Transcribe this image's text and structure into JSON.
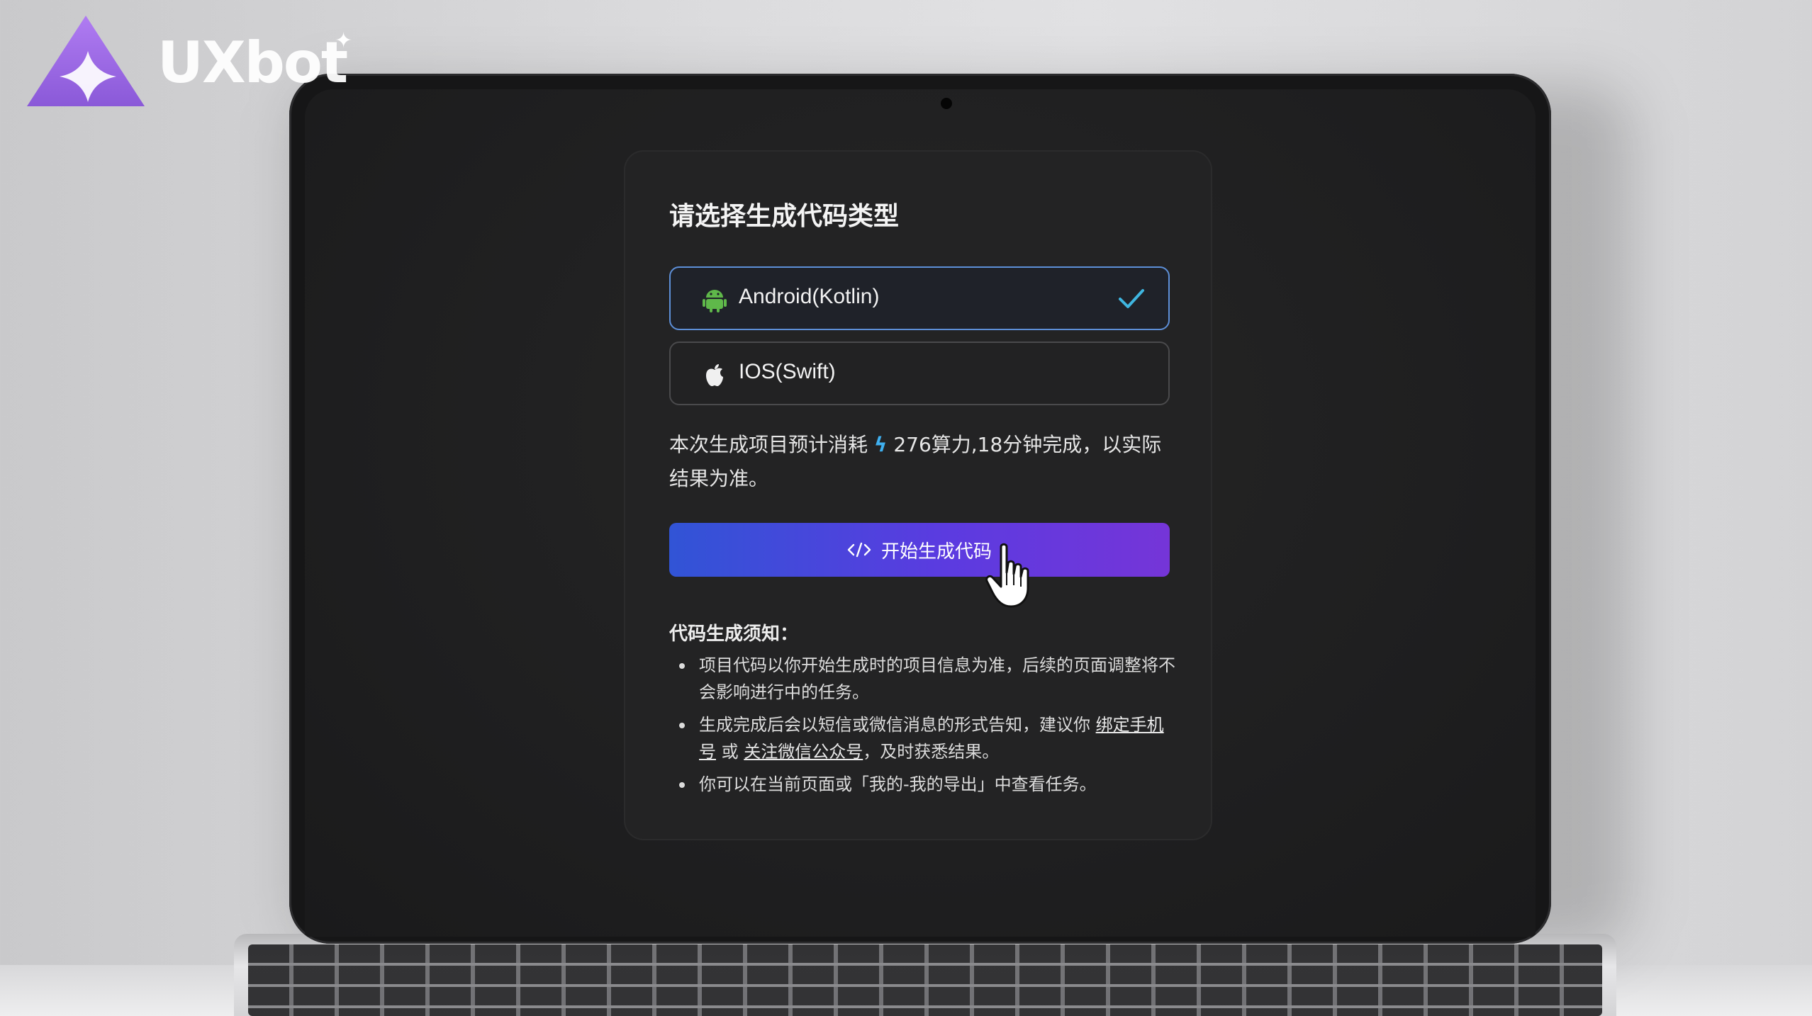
{
  "brand": {
    "name": "UXbot",
    "logo_icon": "uxbot-triangle-logo-icon",
    "sparkle": "✦"
  },
  "dialog": {
    "title": "请选择生成代码类型",
    "options": [
      {
        "label": "Android(Kotlin)",
        "icon": "android-icon",
        "selected": true
      },
      {
        "label": "IOS(Swift)",
        "icon": "apple-icon",
        "selected": false
      }
    ],
    "estimate": {
      "prefix": "本次生成项目预计消耗",
      "bolt": "ϟ",
      "suffix": "276算力,18分钟完成，以实际结果为准。"
    },
    "start_button": {
      "label": "开始生成代码",
      "icon": "code-icon"
    },
    "notice": {
      "title": "代码生成须知：",
      "item1": "项目代码以你开始生成时的项目信息为准，后续的页面调整将不会影响进行中的任务。",
      "item2_pre": "生成完成后会以短信或微信消息的形式告知，建议你 ",
      "item2_link1": "绑定手机号",
      "item2_mid": " 或 ",
      "item2_link2": "关注微信公众号",
      "item2_post": "，及时获悉结果。",
      "item3": "你可以在当前页面或「我的-我的导出」中查看任务。"
    }
  },
  "colors": {
    "accent_start": "#3154d6",
    "accent_end": "#7535d8",
    "selected_border": "#5d8fd7",
    "check": "#3fb6e0",
    "android": "#5fb84a"
  }
}
